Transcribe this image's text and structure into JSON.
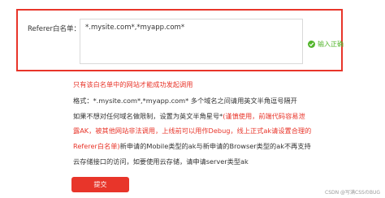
{
  "form": {
    "referer_label": "Referer白名单：",
    "referer_value": "*.mysite.com*,*myapp.com*",
    "valid_message": "输入正确"
  },
  "notes": {
    "warning": "只有该白名单中的网站才能成功发起调用",
    "line1": "格式：*.mysite.com*,*myapp.com* 多个域名之间请用英文半角逗号隔开",
    "line2_a": "如果不想对任何域名做限制，设置为英文半角星号*",
    "line2_b": "(谨慎使用，前端代码容易泄",
    "line3": "露AK，被其他网站非法调用，上线前可以用作Debug，线上正式ak请设置合理的",
    "line4_a": "Referer白名单)",
    "line4_b": "新申请的Mobile类型的ak与新申请的Browser类型的ak不再支持",
    "line5": "云存储接口的访问，如要使用云存储，请申请server类型ak"
  },
  "actions": {
    "submit_label": "提交"
  },
  "watermark": "CSDN @写满CSSのBUG",
  "colors": {
    "accent": "#e8352a",
    "success": "#52b52b",
    "text": "#333333"
  },
  "icons": {
    "valid": "check-circle-icon"
  }
}
